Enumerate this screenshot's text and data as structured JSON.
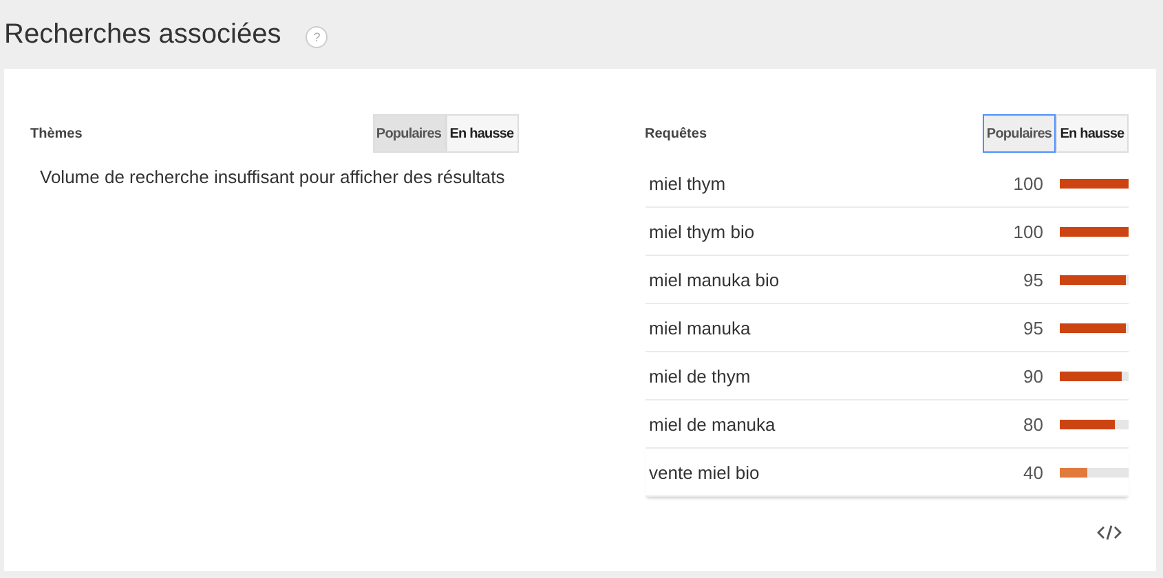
{
  "title": "Recherches associées",
  "help_icon": "?",
  "themes": {
    "heading": "Thèmes",
    "toggle": [
      {
        "label": "Populaires",
        "selected": true,
        "focused": false
      },
      {
        "label": "En hausse",
        "selected": false,
        "focused": false
      }
    ],
    "message": "Volume de recherche insuffisant pour afficher des résultats"
  },
  "queries": {
    "heading": "Requêtes",
    "toggle": [
      {
        "label": "Populaires",
        "selected": true,
        "focused": true
      },
      {
        "label": "En hausse",
        "selected": false,
        "focused": false
      }
    ],
    "rows": [
      {
        "query": "miel thym",
        "value": "100",
        "level": 1.0,
        "color": "#cc4411"
      },
      {
        "query": "miel thym bio",
        "value": "100",
        "level": 1.0,
        "color": "#cc4411"
      },
      {
        "query": "miel manuka bio",
        "value": "95",
        "level": 0.96,
        "color": "#cc4411"
      },
      {
        "query": "miel manuka",
        "value": "95",
        "level": 0.96,
        "color": "#cc4411"
      },
      {
        "query": "miel de thym",
        "value": "90",
        "level": 0.9,
        "color": "#cc4411"
      },
      {
        "query": "miel de manuka",
        "value": "80",
        "level": 0.8,
        "color": "#cc4411"
      },
      {
        "query": "vente miel bio",
        "value": "40",
        "level": 0.4,
        "color": "#e07b3c"
      }
    ]
  }
}
